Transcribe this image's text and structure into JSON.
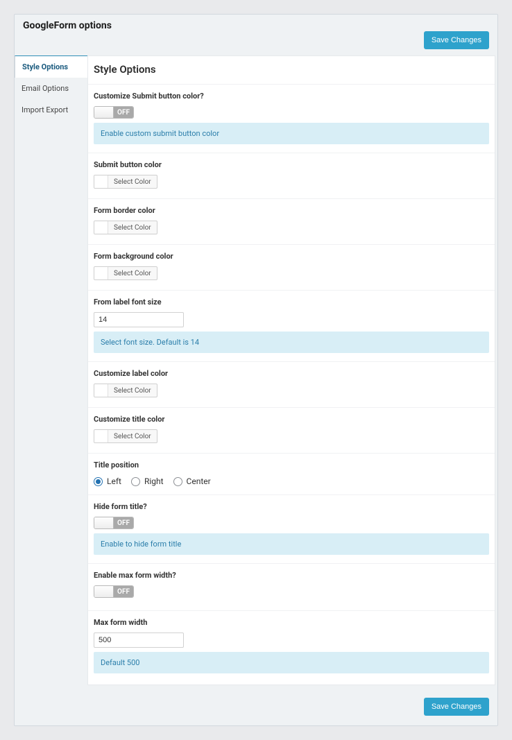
{
  "header": {
    "title": "GoogleForm options",
    "save_label": "Save Changes"
  },
  "sidebar": {
    "tabs": [
      {
        "label": "Style Options",
        "active": true
      },
      {
        "label": "Email Options",
        "active": false
      },
      {
        "label": "Import Export",
        "active": false
      }
    ]
  },
  "section_title": "Style Options",
  "switch_off": "OFF",
  "color_select": "Select Color",
  "fields": {
    "customize_submit": {
      "label": "Customize Submit button color?",
      "help": "Enable custom submit button color"
    },
    "submit_color": {
      "label": "Submit button color"
    },
    "border_color": {
      "label": "Form border color"
    },
    "bg_color": {
      "label": "Form background color"
    },
    "label_font": {
      "label": "From label font size",
      "value": "14",
      "help": "Select font size. Default is 14"
    },
    "label_color": {
      "label": "Customize label color"
    },
    "title_color": {
      "label": "Customize title color"
    },
    "title_position": {
      "label": "Title position",
      "options": [
        "Left",
        "Right",
        "Center"
      ],
      "selected": "Left"
    },
    "hide_title": {
      "label": "Hide form title?",
      "help": "Enable to hide form title"
    },
    "enable_max_width": {
      "label": "Enable max form width?"
    },
    "max_width": {
      "label": "Max form width",
      "value": "500",
      "help": "Default 500"
    }
  },
  "footer": {
    "save_label": "Save Changes"
  }
}
